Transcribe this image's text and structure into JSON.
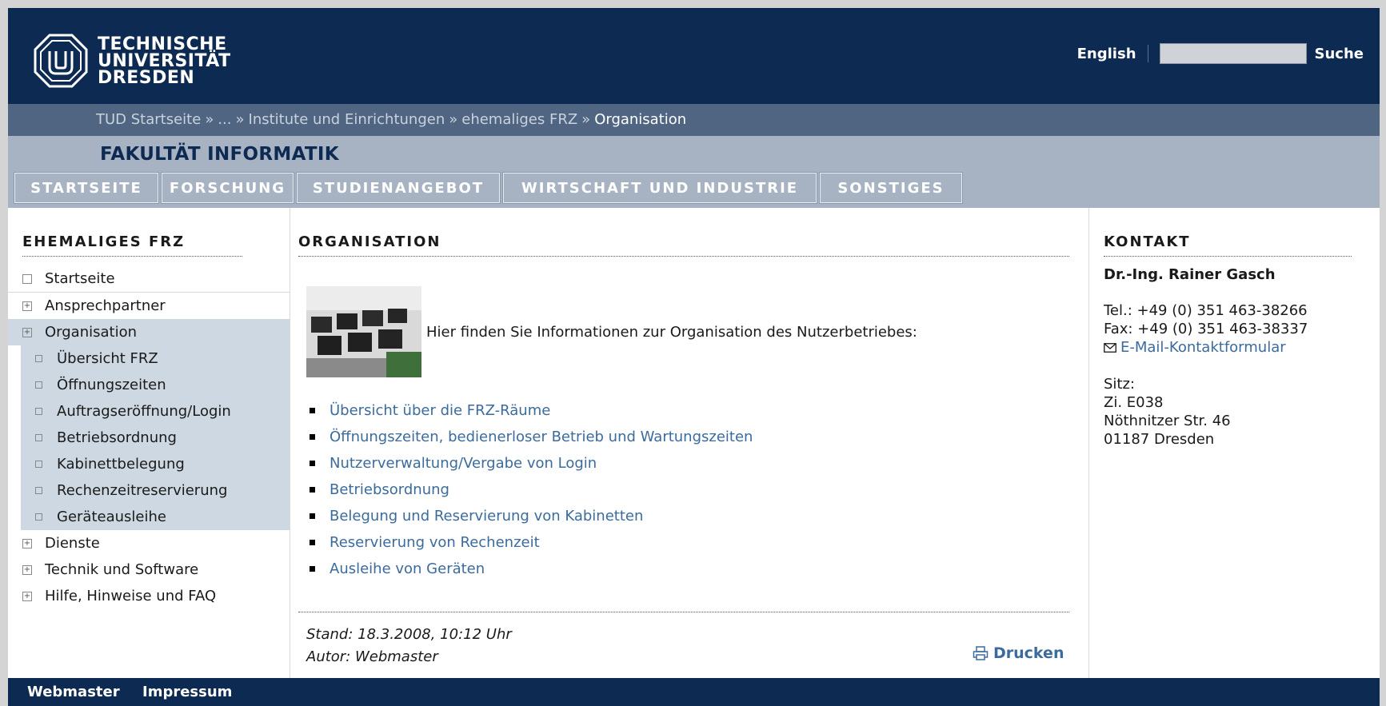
{
  "header": {
    "logo_lines": [
      "TECHNISCHE",
      "UNIVERSITÄT",
      "DRESDEN"
    ],
    "english_link": "English",
    "search_button": "Suche",
    "search_value": ""
  },
  "breadcrumb": {
    "items": [
      "TUD Startseite",
      "...",
      "Institute und Einrichtungen",
      "ehemaliges FRZ"
    ],
    "separator": "»",
    "current": "Organisation"
  },
  "faculty": {
    "title": "FAKULTÄT INFORMATIK"
  },
  "mainnav": [
    "STARTSEITE",
    "FORSCHUNG",
    "STUDIENANGEBOT",
    "WIRTSCHAFT UND INDUSTRIE",
    "SONSTIGES"
  ],
  "sidebar": {
    "heading": "EHEMALIGES FRZ",
    "items": [
      {
        "label": "Startseite",
        "marker": ""
      },
      {
        "label": "Ansprechpartner",
        "marker": "+"
      },
      {
        "label": "Organisation",
        "marker": "+"
      },
      {
        "label": "Übersicht FRZ",
        "marker": ""
      },
      {
        "label": "Öffnungszeiten",
        "marker": ""
      },
      {
        "label": "Auftragseröffnung/Login",
        "marker": ""
      },
      {
        "label": "Betriebsordnung",
        "marker": ""
      },
      {
        "label": "Kabinettbelegung",
        "marker": ""
      },
      {
        "label": "Rechenzeitreservierung",
        "marker": ""
      },
      {
        "label": "Geräteausleihe",
        "marker": ""
      },
      {
        "label": "Dienste",
        "marker": "+"
      },
      {
        "label": "Technik und Software",
        "marker": "+"
      },
      {
        "label": "Hilfe, Hinweise und FAQ",
        "marker": "+"
      }
    ]
  },
  "main": {
    "heading": "ORGANISATION",
    "intro": "Hier finden Sie Informationen zur Organisation des Nutzerbetriebes:",
    "links": [
      "Übersicht über die FRZ-Räume",
      "Öffnungszeiten, bedienerloser Betrieb und Wartungszeiten",
      "Nutzerverwaltung/Vergabe von Login",
      "Betriebsordnung",
      "Belegung und Reservierung von Kabinetten",
      "Reservierung von Rechenzeit",
      "Ausleihe von Geräten"
    ],
    "stand": "Stand: 18.3.2008, 10:12 Uhr",
    "autor": "Autor: Webmaster",
    "print": "Drucken"
  },
  "contact": {
    "heading": "KONTAKT",
    "name": "Dr.-Ing. Rainer Gasch",
    "tel": "Tel.: +49 (0) 351 463-38266",
    "fax": "Fax: +49 (0) 351 463-38337",
    "email_link": "E-Mail-Kontaktformular",
    "sitz_label": "Sitz:",
    "room": "Zi. E038",
    "street": "Nöthnitzer Str. 46",
    "city": "01187 Dresden"
  },
  "footer": {
    "webmaster": "Webmaster",
    "impressum": "Impressum"
  },
  "colors": {
    "header_bg": "#0c2a52",
    "band_bg": "#a7b3c2",
    "breadcrumb_bg": "#4f6582",
    "active_nav": "#cdd8e2",
    "link": "#3b6b9d"
  }
}
